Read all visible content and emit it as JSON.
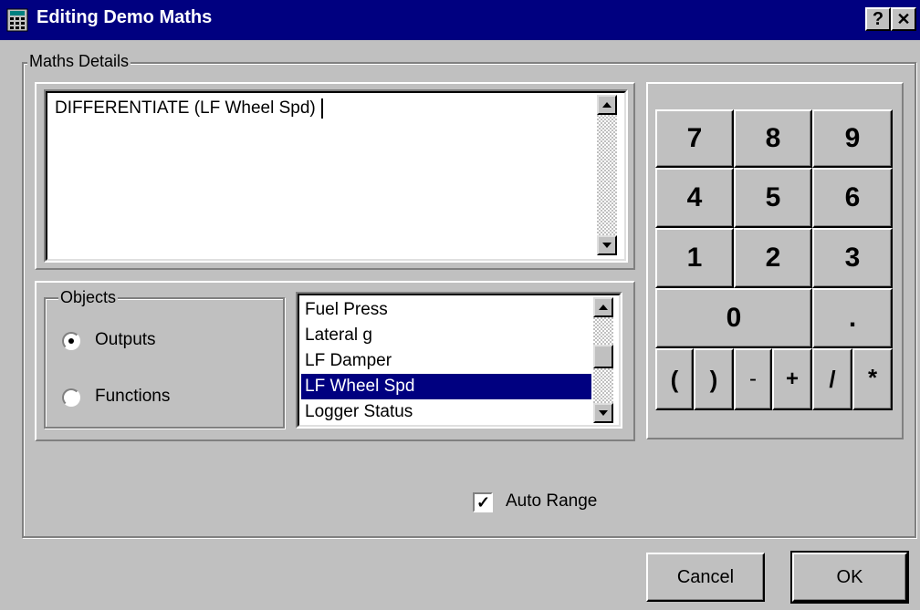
{
  "window": {
    "title": "Editing Demo Maths",
    "help_label": "?",
    "close_label": "✕",
    "title_bar_color": "#000080"
  },
  "maths_details": {
    "label": "Maths Details",
    "expression": "DIFFERENTIATE (LF Wheel Spd)"
  },
  "objects": {
    "label": "Objects",
    "options": [
      {
        "label": "Outputs",
        "selected": true
      },
      {
        "label": "Functions",
        "selected": false
      }
    ],
    "list_items": [
      "Fuel Press",
      "Lateral g",
      "LF Damper",
      "LF Wheel Spd",
      "Logger Status"
    ],
    "selected_item": "LF Wheel Spd"
  },
  "keypad": {
    "rows": [
      [
        "7",
        "8",
        "9"
      ],
      [
        "4",
        "5",
        "6"
      ],
      [
        "1",
        "2",
        "3"
      ]
    ],
    "zero": "0",
    "dot": ".",
    "ops": [
      "(",
      ")",
      "-",
      "+",
      "/",
      "*"
    ]
  },
  "auto_range": {
    "label": "Auto Range",
    "checked": true,
    "check_glyph": "✓"
  },
  "buttons": {
    "cancel": "Cancel",
    "ok": "OK"
  }
}
